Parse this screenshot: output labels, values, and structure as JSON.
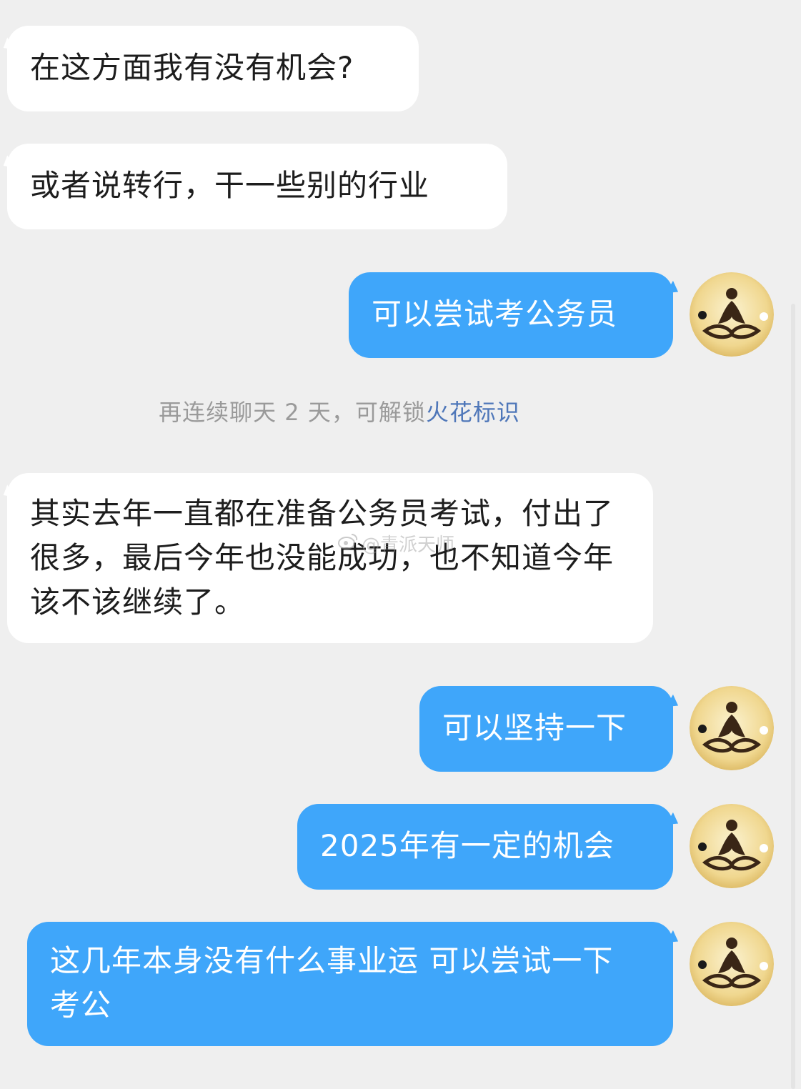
{
  "messages": [
    {
      "side": "in",
      "text": "在这方面我有没有机会?"
    },
    {
      "side": "in",
      "text": "或者说转行，干一些别的行业"
    },
    {
      "side": "out",
      "text": "可以尝试考公务员"
    },
    {
      "side": "in",
      "text": "其实去年一直都在准备公务员考试，付出了很多，最后今年也没能成功，也不知道今年该不该继续了。"
    },
    {
      "side": "out",
      "text": "可以坚持一下"
    },
    {
      "side": "out",
      "text": "2025年有一定的机会"
    },
    {
      "side": "out",
      "text": "这几年本身没有什么事业运 可以尝试一下考公"
    }
  ],
  "system_notice": {
    "prefix": "再连续聊天 2 天，可解锁",
    "link": "火花标识"
  },
  "watermark": {
    "text": "@青派天师"
  },
  "avatar": {
    "icon": "meditating-figure-icon"
  },
  "colors": {
    "background": "#efefef",
    "incoming_bubble": "#ffffff",
    "outgoing_bubble": "#3fa6fa",
    "link": "#4f77b9"
  }
}
